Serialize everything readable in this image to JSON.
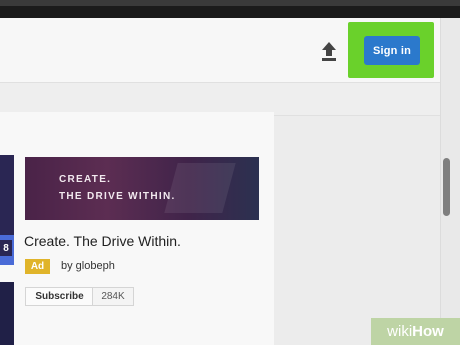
{
  "header": {
    "sign_in_label": "Sign in"
  },
  "video_card": {
    "thumbnail_line1": "CREATE.",
    "thumbnail_line2": "THE DRIVE WITHIN.",
    "title": "Create. The Drive Within.",
    "ad_label": "Ad",
    "byline": "by globeph",
    "subscribe_label": "Subscribe",
    "subscriber_count": "284K"
  },
  "left_thumb_fragment": "8",
  "watermark": {
    "wiki": "wiki",
    "how": "How"
  },
  "colors": {
    "accent": "#2b79cc",
    "highlight": "#6ad12b",
    "ad_badge": "#e0b42a"
  }
}
